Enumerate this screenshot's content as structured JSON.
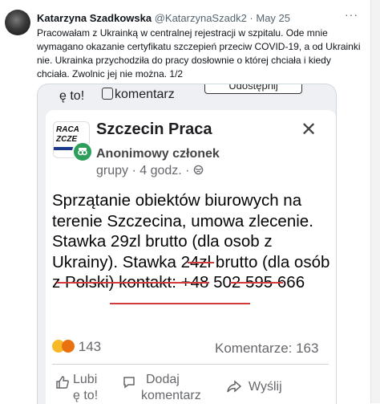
{
  "tweet": {
    "author_name": "Katarzyna Szadkowska",
    "handle": "@KatarzynaSzadk2",
    "separator": " · ",
    "date": "May 25",
    "more_icon": "···",
    "text": "Pracowałam z Ukrainką w centralnej rejestracji w szpitalu. Ode mnie wymagano okazanie certyfikatu szczepień przeciw COVID-19, a od Ukrainki nie. Ukrainka przychodziła do pracy dosłownie o której chciała i kiedy chciała. Zwolnic jej nie można. 1/2"
  },
  "screenshot": {
    "prev_share": "Udostępnij",
    "prev_like": "ę to!",
    "prev_comment": "komentarz",
    "group_name": "Szczecin Praca",
    "logo_line1": "RACA",
    "logo_line2": "ZCZE",
    "member": "Anonimowy członek",
    "group_word": "grupy",
    "time": " · 4 godz. · ",
    "privacy_icon": "globe-icon",
    "close_icon": "✕",
    "post_text": "Sprzątanie obiektów biurowych na terenie Szczecina, umowa zlecenie. Stawka 29zl brutto (dla osob z Ukrainy). Stawka 24zl brutto (dla osób z Polski) kontakt: +48 502 595 666",
    "reaction_count": "143",
    "comments": "Komentarze: 163",
    "like_label_1": "Lubi",
    "like_label_2": "ę to!",
    "comment_label_1": "Dodaj",
    "comment_label_2": "komentarz",
    "share_label": "Wyślij",
    "underline_color": "#d23b3b"
  }
}
